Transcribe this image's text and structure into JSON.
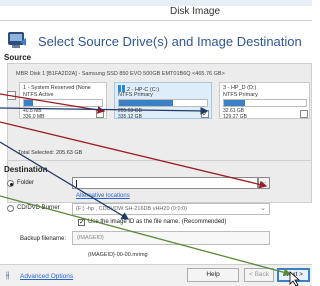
{
  "window": {
    "title": "Disk Image"
  },
  "wizard": {
    "heading": "Select Source Drive(s) and Image Destination"
  },
  "source": {
    "label": "Source",
    "disk_caption": "MBR Disk 1 [B1FA2D2A] - Samsung SSD 850 EVO 500GB EMT01B6Q  <465.76 GB>",
    "partitions": [
      {
        "name": "1 - System Reserved (None",
        "type": "NTFS Active",
        "used_fraction": 0.12,
        "used": "40.8 MB",
        "size": "336.0 MB",
        "checked": false
      },
      {
        "name": "2 - HP-C (C:)",
        "type": "NTFS Primary",
        "used_fraction": 0.61,
        "used": "205.63 GB",
        "size": "335.12 GB",
        "checked": true
      },
      {
        "name": "3 - HP_D (D:)",
        "type": "NTFS Primary",
        "used_fraction": 0.25,
        "used": "32.61 GB",
        "size": "129.27 GB",
        "checked": false
      }
    ],
    "check_mark": "✓",
    "total_label": "Total Selected:",
    "total_value": "205.63 GB"
  },
  "destination": {
    "label": "Destination",
    "folder_option": "Folder",
    "folder_value": "",
    "browse_label": "...",
    "alternative_link": "Alternative locations",
    "burner_option": "CD/DVD Burner",
    "burner_value": "(F:) -hp     , CDDVDW SH-216DB  vHH20 (0:0:0)",
    "dropdown_arrow": "⌄",
    "use_image_id_label": "Use the image ID as the file name.  (Recommended)",
    "use_image_id_checked": "✓",
    "backup_filename_label": "Backup filename:",
    "backup_filename_placeholder": "{IMAGEID}",
    "filename_preview": "{IMAGEID}-00-00.mrimg"
  },
  "footer": {
    "advanced_icon": "⫲",
    "advanced_options": "Advanced Options",
    "help": "Help",
    "back": "< Back",
    "next": "Next >"
  },
  "colors": {
    "accent": "#3b7fc4",
    "heading": "#2f5597",
    "link": "#2a62c9",
    "arrow_red": "#9c1c24",
    "arrow_navy": "#1f3a66",
    "arrow_green": "#5b8a3a"
  }
}
